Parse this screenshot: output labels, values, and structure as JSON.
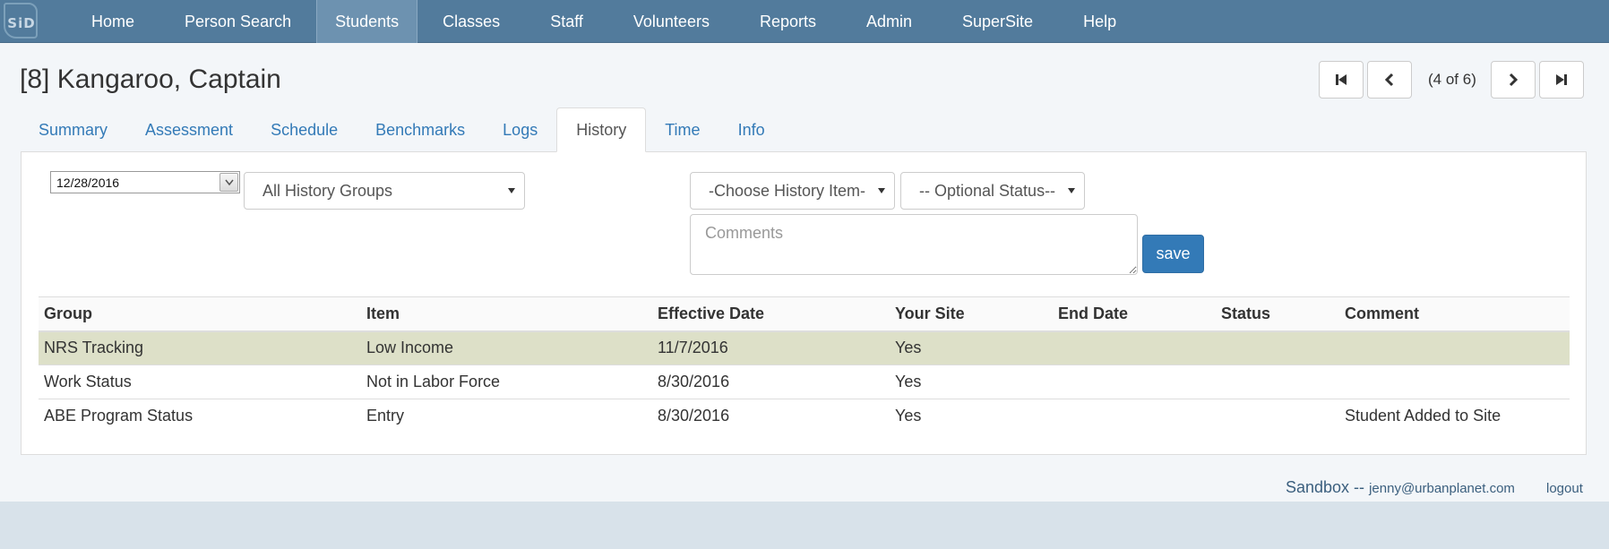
{
  "nav": {
    "logo_text": "SiD",
    "items": [
      {
        "label": "Home"
      },
      {
        "label": "Person Search"
      },
      {
        "label": "Students"
      },
      {
        "label": "Classes"
      },
      {
        "label": "Staff"
      },
      {
        "label": "Volunteers"
      },
      {
        "label": "Reports"
      },
      {
        "label": "Admin"
      },
      {
        "label": "SuperSite"
      },
      {
        "label": "Help"
      }
    ],
    "active": "Students"
  },
  "page": {
    "title": "[8] Kangaroo, Captain"
  },
  "pager": {
    "count": "(4 of 6)"
  },
  "tabs": {
    "items": [
      {
        "label": "Summary"
      },
      {
        "label": "Assessment"
      },
      {
        "label": "Schedule"
      },
      {
        "label": "Benchmarks"
      },
      {
        "label": "Logs"
      },
      {
        "label": "History"
      },
      {
        "label": "Time"
      },
      {
        "label": "Info"
      }
    ],
    "active": "History"
  },
  "form": {
    "date_value": "12/28/2016",
    "history_group": "All History Groups",
    "history_item": "-Choose History Item-",
    "optional_status": "-- Optional Status--",
    "comments_placeholder": "Comments",
    "save_label": "save"
  },
  "table": {
    "headers": {
      "group": "Group",
      "item": "Item",
      "effective_date": "Effective Date",
      "your_site": "Your Site",
      "end_date": "End Date",
      "status": "Status",
      "comment": "Comment"
    },
    "rows": [
      {
        "group": "NRS Tracking",
        "item": "Low Income",
        "effective_date": "11/7/2016",
        "your_site": "Yes",
        "end_date": "",
        "status": "",
        "comment": ""
      },
      {
        "group": "Work Status",
        "item": "Not in Labor Force",
        "effective_date": "8/30/2016",
        "your_site": "Yes",
        "end_date": "",
        "status": "",
        "comment": ""
      },
      {
        "group": "ABE Program Status",
        "item": "Entry",
        "effective_date": "8/30/2016",
        "your_site": "Yes",
        "end_date": "",
        "status": "",
        "comment": "Student Added to Site"
      }
    ]
  },
  "footer": {
    "env": "Sandbox --",
    "email": "jenny@urbanplanet.com",
    "logout": "logout"
  },
  "colors": {
    "nav_bg": "#527b9c",
    "nav_active": "#6d92b0",
    "link": "#337ab7",
    "highlight_row": "#dde0c8",
    "save_button": "#337ab7"
  }
}
